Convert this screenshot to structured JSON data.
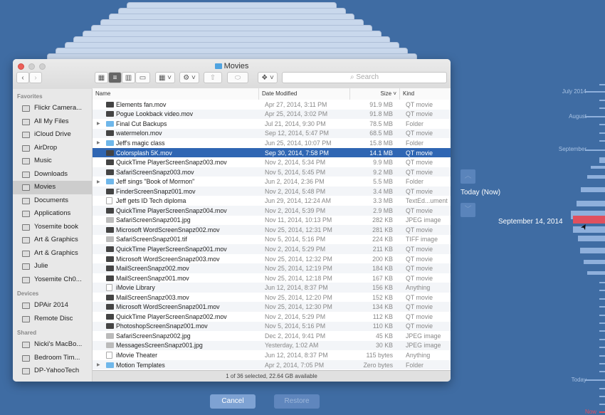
{
  "window": {
    "title": "Movies"
  },
  "toolbar": {
    "search_placeholder": "Search"
  },
  "columns": {
    "name": "Name",
    "date": "Date Modified",
    "size": "Size",
    "kind": "Kind"
  },
  "sidebar": {
    "favorites_label": "Favorites",
    "favorites": [
      {
        "label": "Flickr Camera...",
        "icon": "folder-icon"
      },
      {
        "label": "All My Files",
        "icon": "all-files-icon"
      },
      {
        "label": "iCloud Drive",
        "icon": "cloud-icon"
      },
      {
        "label": "AirDrop",
        "icon": "airdrop-icon"
      },
      {
        "label": "Music",
        "icon": "music-icon"
      },
      {
        "label": "Downloads",
        "icon": "download-icon"
      },
      {
        "label": "Movies",
        "icon": "film-icon",
        "selected": true
      },
      {
        "label": "Documents",
        "icon": "documents-icon"
      },
      {
        "label": "Applications",
        "icon": "applications-icon"
      },
      {
        "label": "Yosemite book",
        "icon": "folder-icon"
      },
      {
        "label": "Art & Graphics",
        "icon": "folder-icon"
      },
      {
        "label": "Art & Graphics",
        "icon": "folder-icon"
      },
      {
        "label": "Julie",
        "icon": "folder-icon"
      },
      {
        "label": "Yosemite Ch0...",
        "icon": "folder-icon"
      }
    ],
    "devices_label": "Devices",
    "devices": [
      {
        "label": "DPAir 2014",
        "icon": "laptop-icon"
      },
      {
        "label": "Remote Disc",
        "icon": "disc-icon"
      }
    ],
    "shared_label": "Shared",
    "shared": [
      {
        "label": "Nicki's MacBo...",
        "icon": "laptop-icon"
      },
      {
        "label": "Bedroom Tim...",
        "icon": "time-capsule-icon"
      },
      {
        "label": "DP-YahooTech",
        "icon": "laptop-icon"
      }
    ]
  },
  "files": [
    {
      "name": "Elements fan.mov",
      "date": "Apr 27, 2014, 3:11 PM",
      "size": "91.9 MB",
      "kind": "QT movie",
      "type": "movie"
    },
    {
      "name": "Pogue Lookback video.mov",
      "date": "Apr 25, 2014, 3:02 PM",
      "size": "91.8 MB",
      "kind": "QT movie",
      "type": "movie"
    },
    {
      "name": "Final Cut Backups",
      "date": "Jul 21, 2014, 9:30 PM",
      "size": "78.5 MB",
      "kind": "Folder",
      "type": "folder"
    },
    {
      "name": "watermelon.mov",
      "date": "Sep 12, 2014, 5:47 PM",
      "size": "68.5 MB",
      "kind": "QT movie",
      "type": "movie"
    },
    {
      "name": "Jeff's magic class",
      "date": "Jun 25, 2014, 10:07 PM",
      "size": "15.8 MB",
      "kind": "Folder",
      "type": "folder"
    },
    {
      "name": "Colorsplash 5K.mov",
      "date": "Sep 30, 2014, 7:58 PM",
      "size": "14.1 MB",
      "kind": "QT movie",
      "type": "movie",
      "selected": true
    },
    {
      "name": "QuickTime PlayerScreenSnapz003.mov",
      "date": "Nov 2, 2014, 5:34 PM",
      "size": "9.9 MB",
      "kind": "QT movie",
      "type": "movie"
    },
    {
      "name": "SafariScreenSnapz003.mov",
      "date": "Nov 5, 2014, 5:45 PM",
      "size": "9.2 MB",
      "kind": "QT movie",
      "type": "movie"
    },
    {
      "name": "Jeff sings \"Book of Mormon\"",
      "date": "Jun 2, 2014, 2:36 PM",
      "size": "5.5 MB",
      "kind": "Folder",
      "type": "folder"
    },
    {
      "name": "FinderScreenSnapz001.mov",
      "date": "Nov 2, 2014, 5:48 PM",
      "size": "3.4 MB",
      "kind": "QT movie",
      "type": "movie"
    },
    {
      "name": "Jeff gets ID Tech diploma",
      "date": "Jun 29, 2014, 12:24 AM",
      "size": "3.3 MB",
      "kind": "TextEd...ument",
      "type": "doc"
    },
    {
      "name": "QuickTime PlayerScreenSnapz004.mov",
      "date": "Nov 2, 2014, 5:39 PM",
      "size": "2.9 MB",
      "kind": "QT movie",
      "type": "movie"
    },
    {
      "name": "SafariScreenSnapz001.jpg",
      "date": "Nov 11, 2014, 10:13 PM",
      "size": "282 KB",
      "kind": "JPEG image",
      "type": "image"
    },
    {
      "name": "Microsoft WordScreenSnapz002.mov",
      "date": "Nov 25, 2014, 12:31 PM",
      "size": "281 KB",
      "kind": "QT movie",
      "type": "movie"
    },
    {
      "name": "SafariScreenSnapz001.tif",
      "date": "Nov 5, 2014, 5:16 PM",
      "size": "224 KB",
      "kind": "TIFF image",
      "type": "image"
    },
    {
      "name": "QuickTime PlayerScreenSnapz001.mov",
      "date": "Nov 2, 2014, 5:29 PM",
      "size": "211 KB",
      "kind": "QT movie",
      "type": "movie"
    },
    {
      "name": "Microsoft WordScreenSnapz003.mov",
      "date": "Nov 25, 2014, 12:32 PM",
      "size": "200 KB",
      "kind": "QT movie",
      "type": "movie"
    },
    {
      "name": "MailScreenSnapz002.mov",
      "date": "Nov 25, 2014, 12:19 PM",
      "size": "184 KB",
      "kind": "QT movie",
      "type": "movie"
    },
    {
      "name": "MailScreenSnapz001.mov",
      "date": "Nov 25, 2014, 12:18 PM",
      "size": "167 KB",
      "kind": "QT movie",
      "type": "movie"
    },
    {
      "name": "iMovie Library",
      "date": "Jun 12, 2014, 8:37 PM",
      "size": "156 KB",
      "kind": "Anything",
      "type": "doc"
    },
    {
      "name": "MailScreenSnapz003.mov",
      "date": "Nov 25, 2014, 12:20 PM",
      "size": "152 KB",
      "kind": "QT movie",
      "type": "movie"
    },
    {
      "name": "Microsoft WordScreenSnapz001.mov",
      "date": "Nov 25, 2014, 12:30 PM",
      "size": "134 KB",
      "kind": "QT movie",
      "type": "movie"
    },
    {
      "name": "QuickTime PlayerScreenSnapz002.mov",
      "date": "Nov 2, 2014, 5:29 PM",
      "size": "112 KB",
      "kind": "QT movie",
      "type": "movie"
    },
    {
      "name": "PhotoshopScreenSnapz001.mov",
      "date": "Nov 5, 2014, 5:16 PM",
      "size": "110 KB",
      "kind": "QT movie",
      "type": "movie"
    },
    {
      "name": "SafariScreenSnapz002.jpg",
      "date": "Dec 2, 2014, 9:41 PM",
      "size": "45 KB",
      "kind": "JPEG image",
      "type": "image"
    },
    {
      "name": "MessagesScreenSnapz001.jpg",
      "date": "Yesterday, 1:02 AM",
      "size": "30 KB",
      "kind": "JPEG image",
      "type": "image"
    },
    {
      "name": "iMovie Theater",
      "date": "Jun 12, 2014, 8:37 PM",
      "size": "115 bytes",
      "kind": "Anything",
      "type": "doc"
    },
    {
      "name": "Motion Templates",
      "date": "Apr 2, 2014, 7:05 PM",
      "size": "Zero bytes",
      "kind": "Folder",
      "type": "folder"
    }
  ],
  "status": "1 of 36 selected, 22.64 GB available",
  "buttons": {
    "cancel": "Cancel",
    "restore": "Restore"
  },
  "timemachine": {
    "current": "Today (Now)",
    "selected_date": "September 14, 2014",
    "timeline_labels": [
      "July 2014",
      "August",
      "September",
      "Today",
      "Now"
    ],
    "accent": "#e0505e"
  }
}
